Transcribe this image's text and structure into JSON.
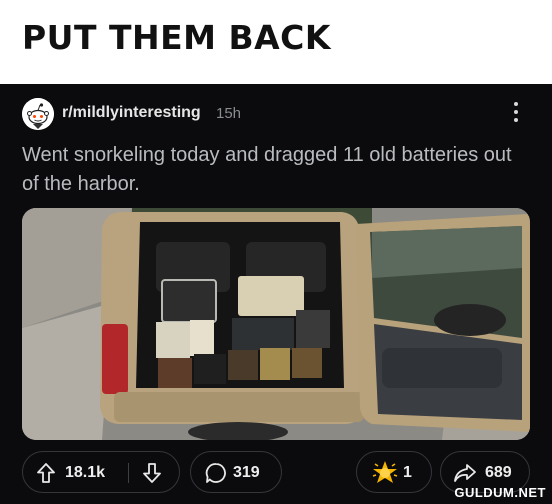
{
  "meme": {
    "caption": "PUT THEM BACK"
  },
  "post": {
    "subreddit": "r/mildlyinteresting",
    "age": "15h",
    "title": "Went snorkeling today and dragged 11 old batteries out of the harbor."
  },
  "actions": {
    "score": "18.1k",
    "comments": "319",
    "awards": "1",
    "shares": "689"
  },
  "icons": {
    "avatar": "reddit-snoo-icon",
    "more": "vertical-dots-icon",
    "upvote": "arrow-up-icon",
    "downvote": "arrow-down-icon",
    "comment": "speech-bubble-icon",
    "award": "award-medal-icon",
    "share": "share-arrow-icon"
  },
  "watermark": "GULDUM.NET",
  "colors": {
    "background": "#0b0b0d",
    "caption_bg": "#ffffff",
    "title_text": "#b9bcbf",
    "meta_text": "#8a8d90"
  }
}
